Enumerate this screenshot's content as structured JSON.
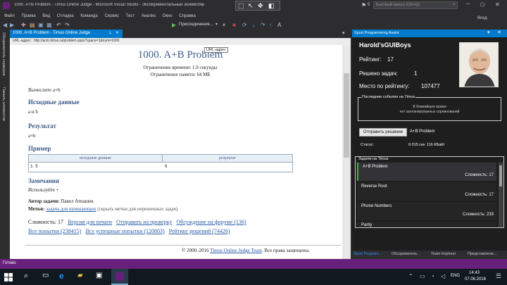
{
  "window": {
    "title": "1000. A+B Problem - Timus Online Judge - Microsoft Visual Studio - Экспериментальный экземпляр",
    "quick_launch_placeholder": "Быстрый запуск (Ctrl+Q)",
    "notif_count": "5",
    "user": "Вход"
  },
  "menu": [
    "Файл",
    "Правка",
    "Вид",
    "Отладка",
    "Команда",
    "Сервис",
    "Тест",
    "Анализ",
    "Окно",
    "Справка"
  ],
  "toolbar": {
    "run_label": "Присоединение..."
  },
  "left_rail": [
    "Обозреватель серверов",
    "Панель элементов"
  ],
  "doc_tab": {
    "label": "1000. A+B Problem - Timus Online Judge"
  },
  "address": {
    "label": "URL-адрес:",
    "url": "http://acm.timus.ru/problem.aspx?space=1&num=1000",
    "tooltip": "URL-адрес"
  },
  "problem": {
    "title": "1000. A+B Problem",
    "time_limit": "Ограничение времени: 1.0 секунды",
    "memory_limit": "Ограничение памяти: 64 МБ",
    "statement": "Вычислите a+b",
    "input_heading": "Исходные данные",
    "input_text": "a и b",
    "output_heading": "Результат",
    "output_text": "a+b",
    "sample_heading": "Пример",
    "sample_cols": [
      "исходные данные",
      "результат"
    ],
    "sample_row": [
      "1 5",
      "6"
    ],
    "notes_heading": "Замечания",
    "notes_text": "Используйте +",
    "author_label": "Автор задачи:",
    "author": "Павел Атнашев",
    "tags_label": "Метки:",
    "tags_link": "задача для начинающих",
    "tags_hide": "(скрыть метки для нерешенных задач)",
    "difficulty": "Сложность: 17",
    "links": [
      "Версия для печати",
      "Отправить на проверку",
      "Обсуждение на форуме (136)",
      "Все попытки (238415)",
      "Все успешные попытки (120803)",
      "Рейтинг решений (74426)"
    ],
    "footer_prefix": "© 2000–2016",
    "footer_link": "Timus Online Judge Team",
    "footer_suffix": ". Все права защищены."
  },
  "panel": {
    "title": "Sport Programming Assist",
    "username": "Harold'sGUIBoys",
    "rating_label": "Рейтинг:",
    "rating_value": "17",
    "solved_label": "Решено задач:",
    "solved_value": "1",
    "place_label": "Место по рейтингу:",
    "place_value": "107477",
    "recent_heading": "Последние события на Timus",
    "recent_line1": "В ближайшее время",
    "recent_line2": "нет запланированных соревнований",
    "submit_button": "Отправить решение",
    "submit_problem": "A+B Problem",
    "status_label": "Статус:",
    "status_time": "0.015 сек",
    "status_mem": "116 КБайт",
    "tasks_heading": "Задачи на Timus",
    "tasks": [
      {
        "name": "A+B Problem",
        "difficulty": "Сложность: 17"
      },
      {
        "name": "Reverse Root",
        "difficulty": "Сложность: 17"
      },
      {
        "name": "Phone Numbers",
        "difficulty": "Сложность: 233"
      },
      {
        "name": "Parity",
        "difficulty": ""
      }
    ],
    "bottom_tabs": [
      "Sport Program...",
      "Обозреватель...",
      "Team Explorer",
      "Представлени..."
    ]
  },
  "status_bar": {
    "text": "Готово"
  },
  "taskbar": {
    "lang": "ENG",
    "time": "14:43",
    "date": "07.06.2016"
  }
}
